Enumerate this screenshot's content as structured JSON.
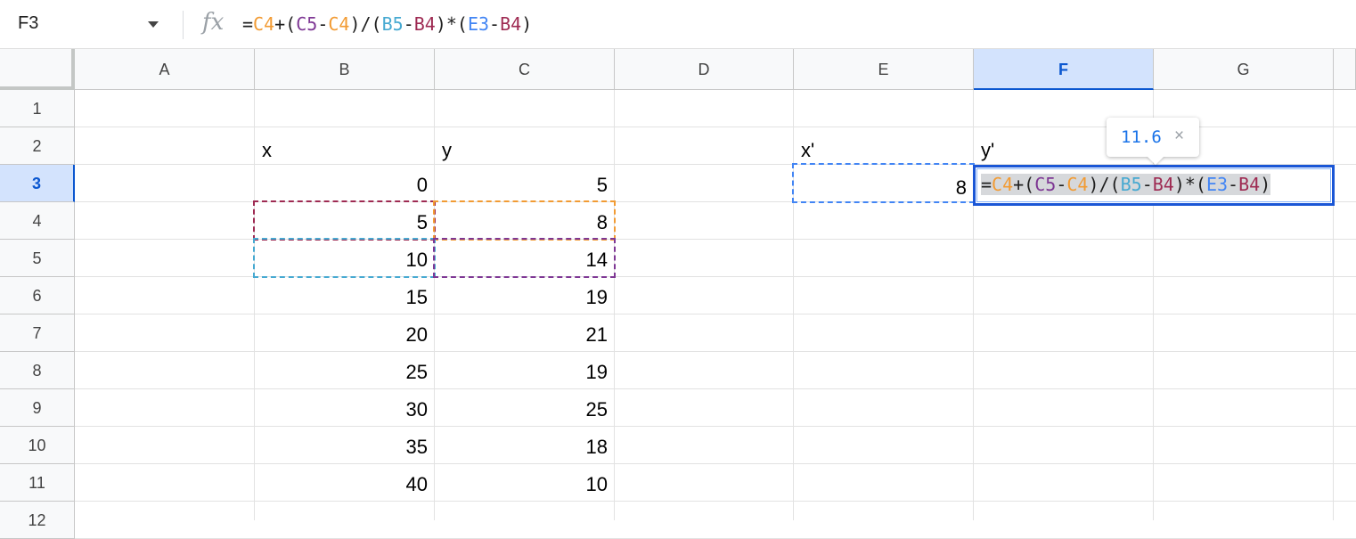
{
  "name_box": "F3",
  "fx_label": "fx",
  "formula_tokens": [
    {
      "t": "=",
      "c": "#1f1f1f"
    },
    {
      "t": "C4",
      "c": "#f29b33"
    },
    {
      "t": "+(",
      "c": "#1f1f1f"
    },
    {
      "t": "C5",
      "c": "#7e3794"
    },
    {
      "t": "-",
      "c": "#1f1f1f"
    },
    {
      "t": "C4",
      "c": "#f29b33"
    },
    {
      "t": ")/(",
      "c": "#1f1f1f"
    },
    {
      "t": "B5",
      "c": "#46a9d1"
    },
    {
      "t": "-",
      "c": "#1f1f1f"
    },
    {
      "t": "B4",
      "c": "#9e2a52"
    },
    {
      "t": ")*(",
      "c": "#1f1f1f"
    },
    {
      "t": "E3",
      "c": "#4285f4"
    },
    {
      "t": "-",
      "c": "#1f1f1f"
    },
    {
      "t": "B4",
      "c": "#9e2a52"
    },
    {
      "t": ")",
      "c": "#1f1f1f"
    }
  ],
  "columns": [
    "A",
    "B",
    "C",
    "D",
    "E",
    "F",
    "G"
  ],
  "selected_column": "F",
  "rows": [
    "1",
    "2",
    "3",
    "4",
    "5",
    "6",
    "7",
    "8",
    "9",
    "10",
    "11",
    "12"
  ],
  "selected_row": "3",
  "headers": {
    "x": "x",
    "y": "y",
    "x_prime": "x'",
    "y_prime": "y'"
  },
  "x_values": [
    "0",
    "5",
    "10",
    "15",
    "20",
    "25",
    "30",
    "35",
    "40"
  ],
  "y_values": [
    "5",
    "8",
    "14",
    "19",
    "21",
    "19",
    "25",
    "18",
    "10"
  ],
  "e3_value": "8",
  "tooltip": {
    "value": "11.6",
    "close": "×"
  },
  "ref_colors": {
    "B4": "#9e2a52",
    "C4": "#f29b33",
    "B5": "#46a9d1",
    "C5": "#7e3794",
    "E3": "#4285f4"
  }
}
